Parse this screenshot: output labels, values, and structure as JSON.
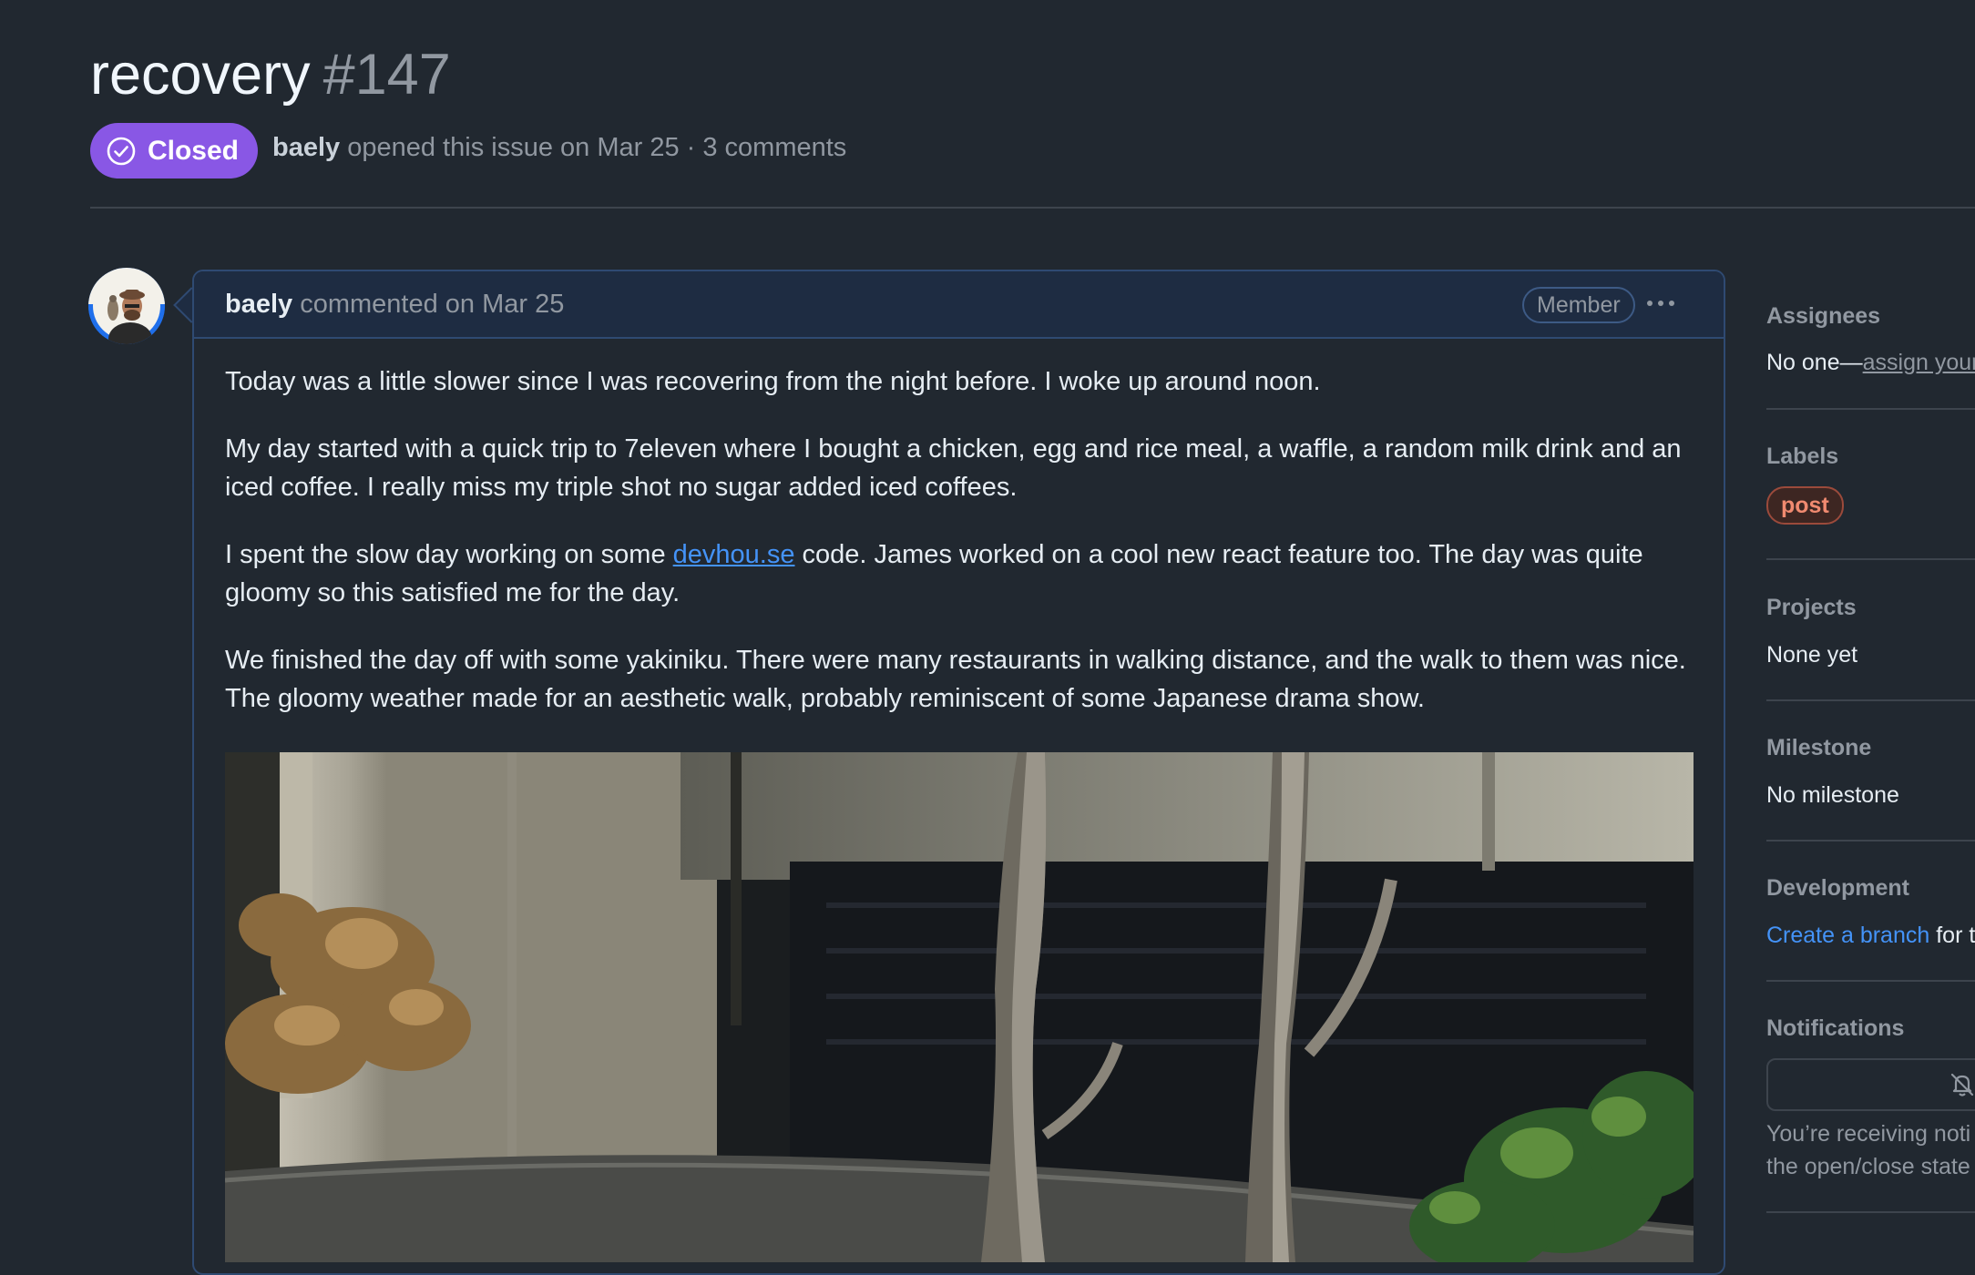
{
  "issue": {
    "title": "recovery",
    "number": "#147",
    "state": "Closed",
    "author": "baely",
    "meta_text": "opened this issue on Mar 25 · 3 comments"
  },
  "comment": {
    "author": "baely",
    "action_text": "commented on Mar 25",
    "role_badge": "Member",
    "paragraphs": {
      "p1": "Today was a little slower since I was recovering from the night before. I woke up around noon.",
      "p2": "My day started with a quick trip to 7eleven where I bought a chicken, egg and rice meal, a waffle, a random milk drink and an iced coffee. I really miss my triple shot no sugar added iced coffees.",
      "p3_before": "I spent the slow day working on some ",
      "p3_link": "devhou.se",
      "p3_after": " code. James worked on a cool new react feature too. The day was quite gloomy so this satisfied me for the day.",
      "p4": "We finished the day off with some yakiniku. There were many restaurants in walking distance, and the walk to them was nice. The gloomy weather made for an aesthetic walk, probably reminiscent of some Japanese drama show."
    }
  },
  "sidebar": {
    "assignees": {
      "heading": "Assignees",
      "value_prefix": "No one—",
      "value_link": "assign your"
    },
    "labels": {
      "heading": "Labels",
      "label": "post",
      "label_color": "#f08a70"
    },
    "projects": {
      "heading": "Projects",
      "value": "None yet"
    },
    "milestone": {
      "heading": "Milestone",
      "value": "No milestone"
    },
    "development": {
      "heading": "Development",
      "link": "Create a branch",
      "suffix": "for t"
    },
    "notifications": {
      "heading": "Notifications",
      "icon": "bell-slash-icon",
      "line1": "You’re receiving noti",
      "line2": "the open/close state"
    }
  },
  "colors": {
    "background": "#212830",
    "closed_badge": "#8957e5",
    "link": "#4493f8",
    "comment_header": "#1e2c42"
  }
}
